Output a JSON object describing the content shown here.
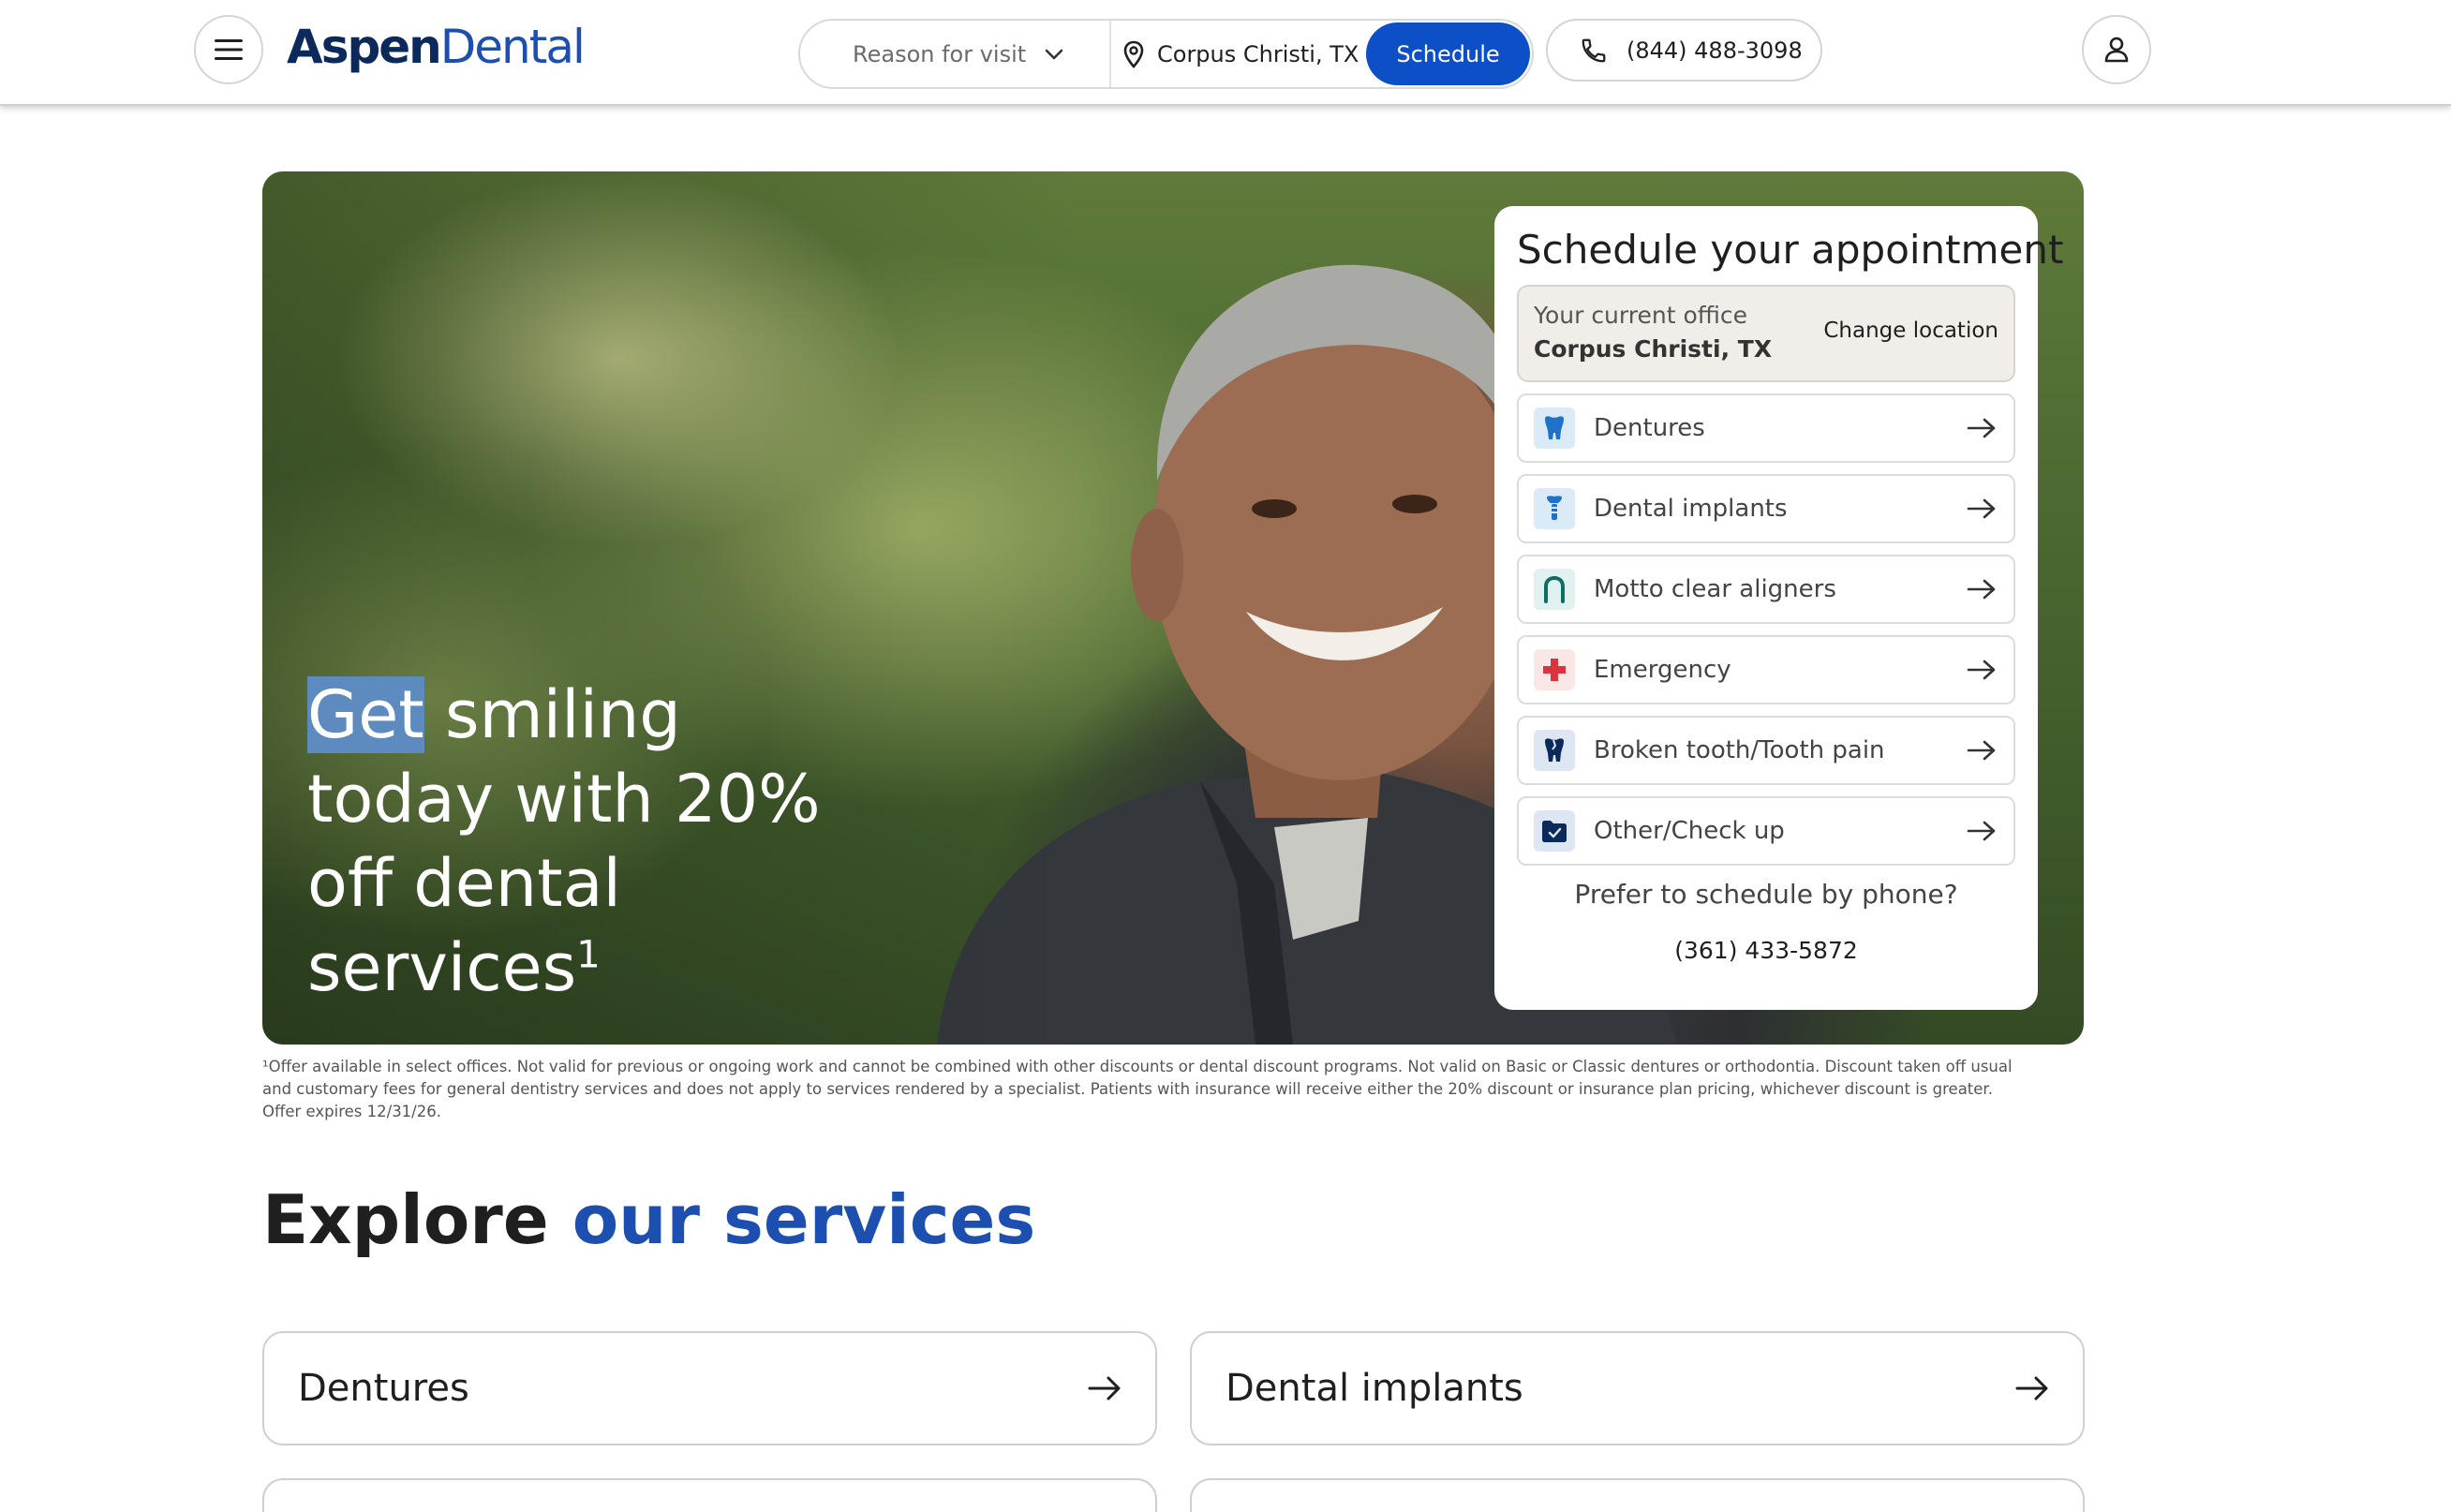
{
  "header": {
    "logo_aspen": "Aspen",
    "logo_dental": "Dental",
    "reason_placeholder": "Reason for visit",
    "location": "Corpus Christi, TX",
    "schedule_label": "Schedule",
    "phone": "(844) 488-3098"
  },
  "hero": {
    "title_highlight": "Get",
    "title_rest": " smiling today with 20% off dental services",
    "footnote_mark": "1"
  },
  "card": {
    "title": "Schedule your appointment",
    "office_label": "Your current office",
    "office_city": "Corpus Christi, TX",
    "change_location": "Change location",
    "services": [
      {
        "label": "Dentures",
        "icon": "denture-icon"
      },
      {
        "label": "Dental implants",
        "icon": "implant-icon"
      },
      {
        "label": "Motto clear aligners",
        "icon": "aligner-icon"
      },
      {
        "label": "Emergency",
        "icon": "emergency-cross-icon"
      },
      {
        "label": "Broken tooth/Tooth pain",
        "icon": "broken-tooth-icon"
      },
      {
        "label": "Other/Check up",
        "icon": "checkup-icon"
      }
    ],
    "prefer_phone": "Prefer to schedule by phone?",
    "phone": "(361) 433-5872"
  },
  "disclaimer": "¹Offer available in select offices. Not valid for previous or ongoing work and cannot be combined with other discounts or dental discount programs. Not valid on Basic or Classic dentures or orthodontia. Discount taken off usual and customary fees for general dentistry services and does not apply to services rendered by a specialist. Patients with insurance will receive either the 20% discount or insurance plan pricing, whichever discount is greater. Offer expires 12/31/26.",
  "explore": {
    "title_plain": "Explore ",
    "title_accent": "our services",
    "tiles": [
      {
        "label": "Dentures"
      },
      {
        "label": "Dental implants"
      }
    ]
  },
  "colors": {
    "brand_blue": "#0d4fc7",
    "logo_navy": "#0b2a5b",
    "accent_blue": "#1c4fb0"
  }
}
